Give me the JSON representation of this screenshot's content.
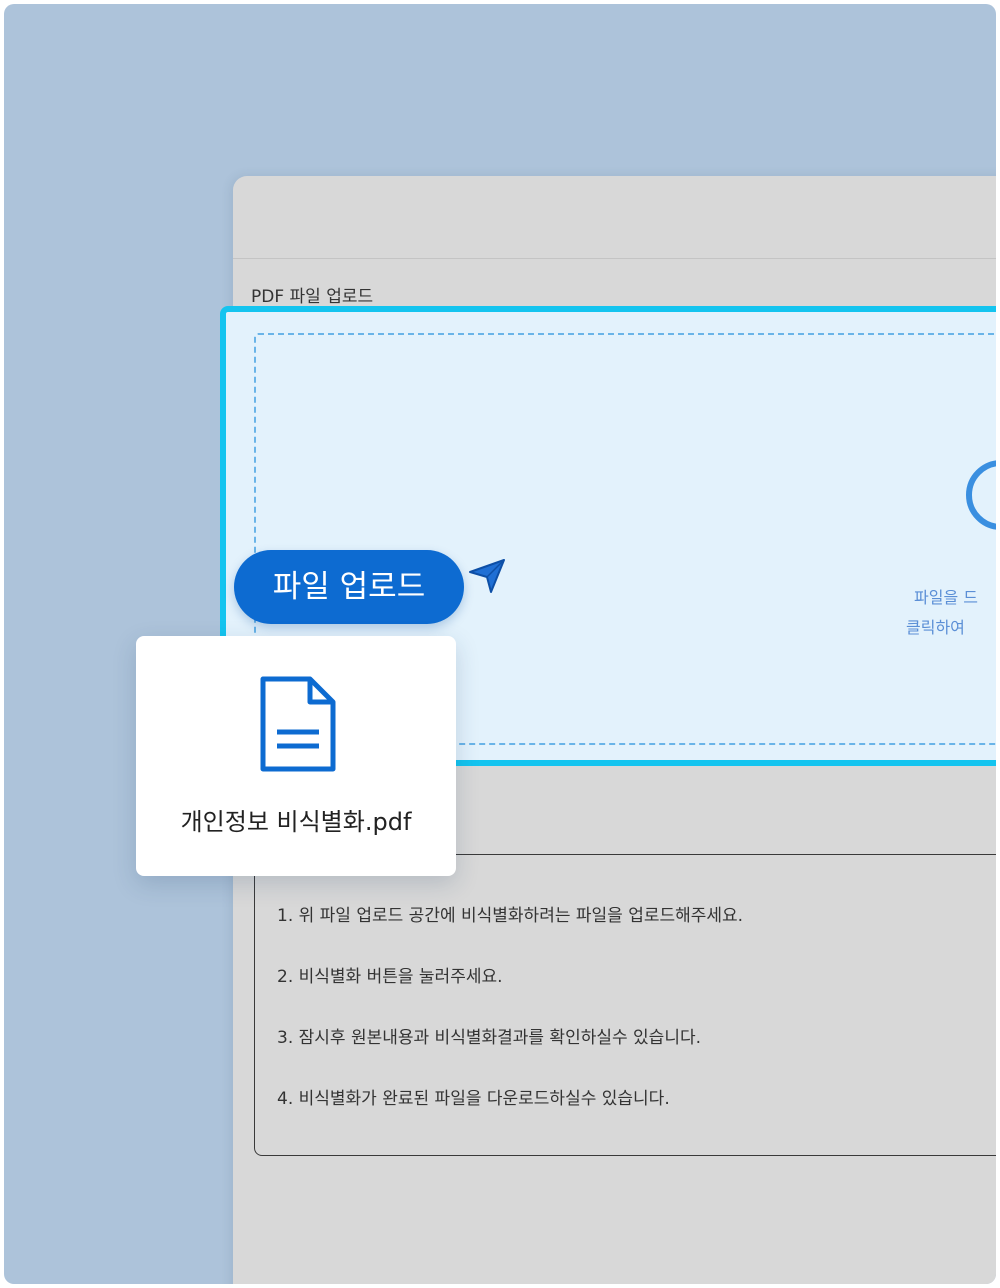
{
  "upload_section": {
    "label": "PDF 파일 업로드",
    "hint_line1": "파일을 드",
    "hint_line2": "클릭하여"
  },
  "instructions": [
    "1. 위 파일 업로드 공간에 비식별화하려는 파일을 업로드해주세요.",
    "2. 비식별화 버튼을 눌러주세요.",
    "3. 잠시후 원본내용과 비식별화결과를 확인하실수 있습니다.",
    "4. 비식별화가 완료된 파일을 다운로드하실수 있습니다."
  ],
  "overlay": {
    "upload_button_label": "파일 업로드",
    "file_name": "개인정보 비식별화.pdf",
    "file_icon": "document-icon",
    "cursor_icon": "pointer-arrow-icon"
  },
  "colors": {
    "background": "#adc3da",
    "window": "#d8d8d8",
    "dropzone_border": "#14c4ef",
    "dropzone_fill": "#e3f2fc",
    "accent": "#0d6bd1"
  }
}
